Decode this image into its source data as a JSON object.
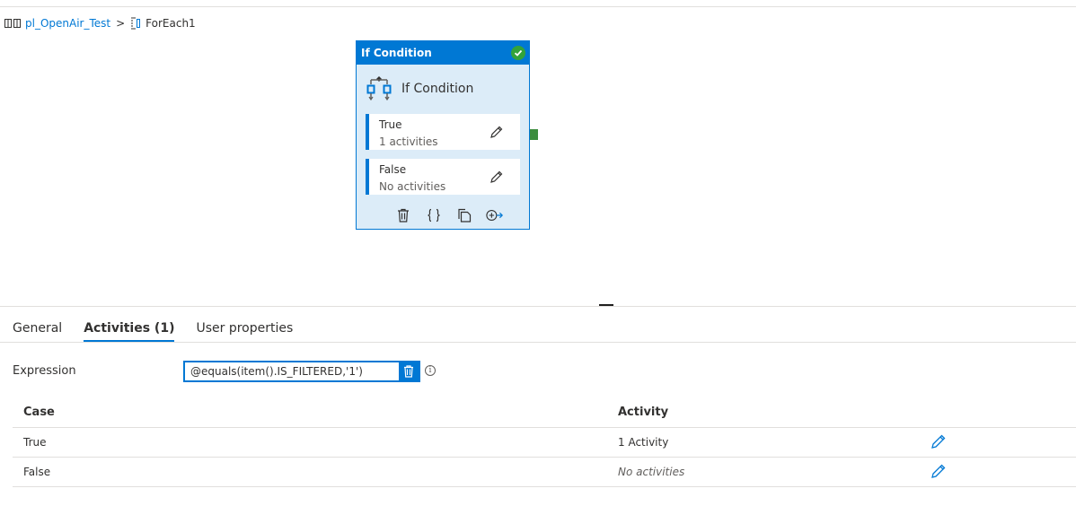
{
  "breadcrumb": {
    "pipeline": "pl_OpenAir_Test",
    "separator": ">",
    "current": "ForEach1"
  },
  "activity_card": {
    "header_title": "If Condition",
    "title": "If Condition",
    "branches": [
      {
        "name": "True",
        "count": "1 activities"
      },
      {
        "name": "False",
        "count": "No activities"
      }
    ],
    "actions": [
      "delete-icon",
      "code-icon",
      "copy-icon",
      "add-output-icon"
    ]
  },
  "tabs": [
    {
      "label": "General",
      "active": false
    },
    {
      "label": "Activities (1)",
      "active": true
    },
    {
      "label": "User properties",
      "active": false
    }
  ],
  "expression": {
    "label": "Expression",
    "value": "@equals(item().IS_FILTERED,'1')"
  },
  "table": {
    "headers": {
      "case": "Case",
      "activity": "Activity"
    },
    "rows": [
      {
        "case": "True",
        "activity": "1 Activity"
      },
      {
        "case": "False",
        "activity": "No activities"
      }
    ]
  },
  "colors": {
    "accent": "#0078d4",
    "success": "#33a33a",
    "card_bg": "#dcecf8"
  }
}
